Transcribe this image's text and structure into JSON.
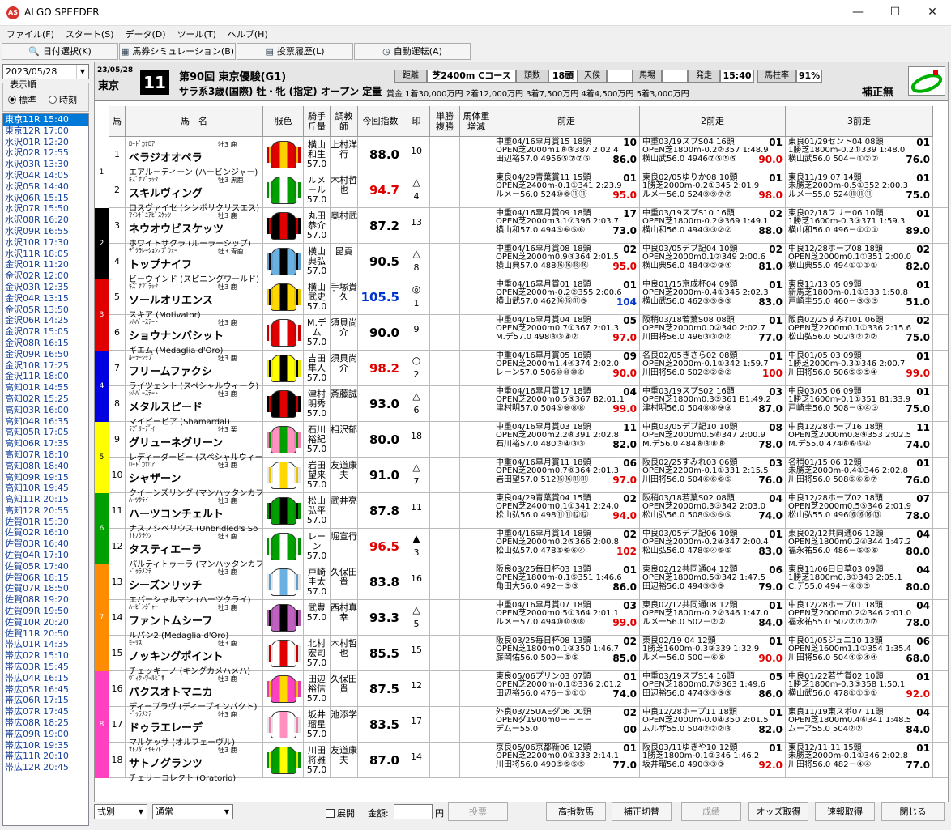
{
  "app": {
    "title": "ALGO SPEEDER",
    "icon": "AS"
  },
  "window": {
    "minimize": "—",
    "maximize": "☐",
    "close": "✕"
  },
  "menu": [
    "ファイル(F)",
    "スタート(S)",
    "データ(D)",
    "ツール(T)",
    "ヘルプ(H)"
  ],
  "toolbar": [
    {
      "icon": "🔍",
      "label": "日付選択(K)"
    },
    {
      "icon": "▦",
      "label": "馬券シミュレーション(B)"
    },
    {
      "icon": "▤",
      "label": "投票履歴(L)"
    },
    {
      "icon": "◷",
      "label": "自動運転(A)"
    }
  ],
  "left": {
    "date": "2023/05/28",
    "order_label": "表示順",
    "opt_standard": "標準",
    "opt_time": "時刻",
    "races": [
      "東京11R 15:40",
      "東京12R 17:00",
      "水沢01R 12:20",
      "水沢02R 12:55",
      "水沢03R 13:30",
      "水沢04R 14:05",
      "水沢05R 14:40",
      "水沢06R 15:15",
      "水沢07R 15:50",
      "水沢08R 16:20",
      "水沢09R 16:55",
      "水沢10R 17:30",
      "水沢11R 18:05",
      "金沢01R 11:20",
      "金沢02R 12:00",
      "金沢03R 12:35",
      "金沢04R 13:15",
      "金沢05R 13:50",
      "金沢06R 14:25",
      "金沢07R 15:05",
      "金沢08R 16:15",
      "金沢09R 16:50",
      "金沢10R 17:25",
      "金沢11R 18:00",
      "高知01R 14:55",
      "高知02R 15:25",
      "高知03R 16:00",
      "高知04R 16:35",
      "高知05R 17:05",
      "高知06R 17:35",
      "高知07R 18:10",
      "高知08R 18:40",
      "高知09R 19:15",
      "高知10R 19:45",
      "高知11R 20:15",
      "高知12R 20:55",
      "佐賀01R 15:30",
      "佐賀02R 16:10",
      "佐賀03R 16:40",
      "佐賀04R 17:10",
      "佐賀05R 17:40",
      "佐賀06R 18:15",
      "佐賀07R 18:50",
      "佐賀08R 19:20",
      "佐賀09R 19:50",
      "佐賀10R 20:20",
      "佐賀11R 20:50",
      "帯広01R 14:35",
      "帯広02R 15:10",
      "帯広03R 15:45",
      "帯広04R 16:15",
      "帯広05R 16:45",
      "帯広06R 17:15",
      "帯広07R 17:45",
      "帯広08R 18:25",
      "帯広09R 19:00",
      "帯広10R 19:35",
      "帯広11R 20:10",
      "帯広12R 20:45"
    ]
  },
  "race": {
    "date": "23/05/28",
    "place": "東京",
    "no": "11",
    "name": "第90回 東京優駿(G1)",
    "cond": "サラ系3歳(国際) 牡・牝 (指定) オープン 定量",
    "prize": "賞金 1着30,000万円 2着12,000万円 3着7,500万円 4着4,500万円 5着3,000万円",
    "dist_label": "距離",
    "dist": "芝2400m Cコース",
    "heads_label": "頭数",
    "heads": "18頭",
    "weather_label": "天候",
    "weather": "",
    "going_label": "馬場",
    "going": "",
    "post_label": "発走",
    "post": "15:40",
    "rate_label": "馬柱率",
    "rate": "91%",
    "fix": "補正無"
  },
  "cols": {
    "umaban": "馬",
    "name": "馬　名",
    "silk": "服色",
    "jockey": "騎手斤量",
    "trainer": "調教師",
    "idx": "今回指数",
    "mark": "印",
    "odds": "単勝複勝",
    "wt": "馬体重増減",
    "p1": "前走",
    "p2": "2前走",
    "p3": "3前走"
  },
  "colors": {
    "waku": [
      "#ffffff",
      "#000000",
      "#e00000",
      "#0000e0",
      "#ffff00",
      "#00a000",
      "#ff8c00",
      "#ff40c0"
    ]
  },
  "horses": [
    {
      "waku": "1",
      "no": "1",
      "sire": "ﾛｰﾄﾞｶﾅﾛｱ",
      "sex": "牡3 鹿",
      "name": "ベラジオオペラ",
      "dam": "エアルーティーン (ハービンジャー)",
      "jockey": "横山和生",
      "kin": "57.0",
      "trainer": "上村洋行",
      "idx": "88.0",
      "idxc": "#000",
      "mark": "",
      "pop": "10",
      "silk": [
        "#e00000",
        "#ffd000"
      ],
      "p1": [
        "中重04/16皐月賞15 18頭",
        "10",
        "OPEN芝2000m1⑧③387 2:02.4",
        "田辺裕57.0 4956⑤⑦⑦⑤",
        "86.0"
      ],
      "p2": [
        "中重03/19スプS04 16頭",
        "01",
        "OPEN芝1800m-0.2②357 1:48.9",
        "横山武56.0 4946⑦⑤⑤⑤",
        "90.0"
      ],
      "p3": [
        "東良01/29セント04 08頭",
        "01",
        "1勝芝1800m-0.2①339 1:48.0",
        "横山武56.0 504－①②②",
        "76.0"
      ]
    },
    {
      "waku": "1",
      "no": "2",
      "sire": "ｷｽﾞﾅﾌﾞﾗｯｸ",
      "sex": "牡3 黒鹿",
      "name": "スキルヴィング",
      "dam": "ロスヴァイセ (シンボリクリスエス)",
      "jockey": "ルメール",
      "kin": "57.0",
      "trainer": "木村哲也",
      "idx": "94.7",
      "idxc": "#e00000",
      "mark": "△",
      "pop": "4",
      "silk": [
        "#00a000",
        "#ffffff"
      ],
      "p1": [
        "東良04/29青葉賞11 15頭",
        "01",
        "OPEN芝2400m-0.1①341 2:23.9",
        "ルメー56.0 524⑩⑧⑪⑪",
        "95.0"
      ],
      "p2": [
        "東良02/05ゆりか08 10頭",
        "01",
        "1勝芝2000m-0.2①345 2:01.9",
        "ルメー56.0 524⑨⑨⑦⑦",
        "98.0"
      ],
      "p3": [
        "東良11/19 07 14頭",
        "01",
        "未勝芝2000m-0.5①352 2:00.3",
        "ルメー55.0 524⑪⑪⑪",
        "75.0"
      ]
    },
    {
      "waku": "2",
      "no": "3",
      "sire": "ﾏｲﾝﾄﾞﾕｱﾋﾞｽｹｯﾂ",
      "sex": "牡3 鹿",
      "name": "ネウオウビスケッツ",
      "dam": "ホワイトサクラ (ルーラーシップ)",
      "jockey": "丸田恭介",
      "kin": "57.0",
      "trainer": "奥村武",
      "idx": "87.2",
      "idxc": "#000",
      "mark": "",
      "pop": "13",
      "silk": [
        "#000000",
        "#e00000"
      ],
      "p1": [
        "中重04/16皐月賞09 18頭",
        "17",
        "OPEN芝2000m3.1⑦396 2:03.7",
        "横山和57.0 494⑤⑥⑤⑥",
        "73.0"
      ],
      "p2": [
        "中重03/19スプS10 16頭",
        "02",
        "OPEN芝1800m-0.2③369 1:49.1",
        "横山和56.0 494③③②②",
        "88.0"
      ],
      "p3": [
        "東良02/18フリー06 10頭",
        "01",
        "1勝芝1600m-0.3③371 1:59.3",
        "横山和56.0 496－①①①",
        "89.0"
      ]
    },
    {
      "waku": "2",
      "no": "4",
      "sire": "ﾃﾞｸﾗﾚｰｼｮﾝｵﾌﾞｳｫｰ",
      "sex": "牡3 青鹿",
      "name": "トップナイフ",
      "dam": "ビーウインド (スピニングワールド)",
      "jockey": "横山典弘",
      "kin": "57.0",
      "trainer": "昆貢",
      "idx": "90.5",
      "idxc": "#000",
      "mark": "△",
      "pop": "8",
      "silk": [
        "#6ab0e0",
        "#000000"
      ],
      "p1": [
        "中重04/16皐月賞08 18頭",
        "02",
        "OPEN芝2000m0.9③364 2:01.5",
        "横山典57.0 488⑯⑯⑱⑯",
        "95.0"
      ],
      "p2": [
        "中良03/05デブ記04 10頭",
        "02",
        "OPEN芝2000m0.1②349 2:00.6",
        "横山典56.0 484③②③④",
        "81.0"
      ],
      "p3": [
        "中良12/28ホープ08 18頭",
        "02",
        "OPEN芝2000m0.1①351 2:00.0",
        "横山典55.0 494①①①①",
        "82.0"
      ]
    },
    {
      "waku": "3",
      "no": "5",
      "sire": "ｷｽﾞﾅﾌﾞﾗｯｸ",
      "sex": "牡3 鹿",
      "name": "ソールオリエンス",
      "dam": "スキア (Motivator)",
      "jockey": "横山武史",
      "kin": "57.0",
      "trainer": "手塚貴久",
      "idx": "105.5",
      "idxc": "#0033cc",
      "mark": "◎",
      "pop": "1",
      "silk": [
        "#ffd800",
        "#000000"
      ],
      "p1": [
        "中重04/16皐月賞01 18頭",
        "01",
        "OPEN芝2000m-0.2②355 2:00.6",
        "横山武57.0 462⑯⑮⑪⑤",
        "104"
      ],
      "p2": [
        "中良01/15京成杯04 09頭",
        "01",
        "OPEN芝2000m-0.4①345 2:02.3",
        "横山武56.0 462⑤⑤⑤⑤",
        "83.0"
      ],
      "p3": [
        "東良11/13 05 09頭",
        "01",
        "新馬芝1800m-0.1①333 1:50.8",
        "戸崎圭55.0 460－③③③",
        "51.0"
      ]
    },
    {
      "waku": "3",
      "no": "6",
      "sire": "ｼﾙﾊﾞｰｽﾃｰﾄ",
      "sex": "牡3 鹿",
      "name": "ショウナンバシット",
      "dam": "ギエム (Medaglia d'Oro)",
      "jockey": "M.デム",
      "kin": "57.0",
      "trainer": "須貝尚介",
      "idx": "90.0",
      "idxc": "#000",
      "mark": "",
      "pop": "9",
      "silk": [
        "#e00000",
        "#ffffff"
      ],
      "p1": [
        "中重04/16皐月賞04 18頭",
        "05",
        "OPEN芝2000m0.7①367 2:01.3",
        "M.デ57.0 498③③④②",
        "97.0"
      ],
      "p2": [
        "阪稍03/18若葉S08 08頭",
        "01",
        "OPEN芝2000m0.0②340 2:02.7",
        "川田将56.0 496③③②②",
        "77.0"
      ],
      "p3": [
        "阪良02/25すみれ01 06頭",
        "02",
        "OPEN芝2200m0.1①336 2:15.6",
        "松山弘56.0 502③②②②",
        "75.0"
      ]
    },
    {
      "waku": "4",
      "no": "7",
      "sire": "ﾙｰﾗｰｼｯﾌﾟ",
      "sex": "牡3 鹿",
      "name": "フリームファクシ",
      "dam": "ライツェント (スペシャルウィーク)",
      "jockey": "吉田隼人",
      "kin": "57.0",
      "trainer": "須貝尚介",
      "idx": "98.2",
      "idxc": "#e00000",
      "mark": "○",
      "pop": "2",
      "silk": [
        "#ffff00",
        "#000000"
      ],
      "p1": [
        "中重04/16皐月賞05 18頭",
        "09",
        "OPEN芝2000m1.4④374 2:02.0",
        "レーン57.0 506⑩⑩⑩⑧",
        "90.0"
      ],
      "p2": [
        "名良02/05きさら02 08頭",
        "01",
        "OPEN芝2000m-0.1①342 1:59.7",
        "川田将56.0 502②②②②",
        "100"
      ],
      "p3": [
        "中良01/05 03 09頭",
        "01",
        "1勝芝2000m-0.3①346 2:00.7",
        "川田将56.0 506⑤⑤⑤④",
        "99.0"
      ]
    },
    {
      "waku": "4",
      "no": "8",
      "sire": "ｼﾙﾊﾞｰｽﾃｰﾄ",
      "sex": "牡3 鹿",
      "name": "メタルスピード",
      "dam": "マイビービア (Shamardal)",
      "jockey": "津村明秀",
      "kin": "57.0",
      "trainer": "斎藤誠",
      "idx": "93.0",
      "idxc": "#000",
      "mark": "△",
      "pop": "6",
      "silk": [
        "#000000",
        "#e00000"
      ],
      "p1": [
        "中重04/16皐月賞17 18頭",
        "04",
        "OPEN芝2000m0.5③367 B2:01.1",
        "津村明57.0 504⑨⑧⑧⑧",
        "99.0"
      ],
      "p2": [
        "中重03/19スプS02 16頭",
        "03",
        "OPEN芝1800m0.3③361 B1:49.2",
        "津村明56.0 504⑧⑧⑨⑨",
        "87.0"
      ],
      "p3": [
        "中良03/05 06 09頭",
        "01",
        "1勝芝1600m-0.1①351 B1:33.9",
        "戸崎圭56.0 508－④④③",
        "75.0"
      ]
    },
    {
      "waku": "5",
      "no": "9",
      "sire": "ﾗﾌﾞﾘｰﾃﾞｲ",
      "sex": "牡3 栗",
      "name": "グリューネグリーン",
      "dam": "レディーダービー (スペシャルウィーク)",
      "jockey": "石川裕紀",
      "kin": "57.0",
      "trainer": "相沢郁",
      "idx": "80.0",
      "idxc": "#000",
      "mark": "",
      "pop": "18",
      "silk": [
        "#ff90c0",
        "#00a000"
      ],
      "p1": [
        "中重04/16皐月賞03 18頭",
        "11",
        "OPEN芝2000m2.2⑧391 2:02.8",
        "石川裕57.0 480③④③③",
        "82.0"
      ],
      "p2": [
        "中良03/05デブ記10 10頭",
        "08",
        "OPEN芝2000m0.5⑥347 2:00.9",
        "M.デ56.0 484⑧⑧⑧⑧",
        "78.0"
      ],
      "p3": [
        "中良12/28ホープ16 18頭",
        "11",
        "OPEN芝2000m0.8⑨353 2:02.5",
        "M.デ55.0 474⑥⑥⑥④",
        "74.0"
      ]
    },
    {
      "waku": "5",
      "no": "10",
      "sire": "ﾛｰﾄﾞｶﾅﾛｱ",
      "sex": "牡3 鹿",
      "name": "シャザーン",
      "dam": "クイーンズリング (マンハッタンカフェ)",
      "jockey": "岩田望来",
      "kin": "57.0",
      "trainer": "友道康夫",
      "idx": "91.0",
      "idxc": "#000",
      "mark": "△",
      "pop": "7",
      "silk": [
        "#ffffff",
        "#ffd800"
      ],
      "p1": [
        "中重04/16皐月賞11 18頭",
        "06",
        "OPEN芝2000m0.7⑧364 2:01.3",
        "岩田望57.0 512⑮⑯⑪⑪",
        "97.0"
      ],
      "p2": [
        "阪良02/25すみれ03 06頭",
        "03",
        "OPEN芝2200m-0.1①331 2:15.5",
        "川田将56.0 504⑥⑥⑥⑥",
        "76.0"
      ],
      "p3": [
        "名稍01/15 06 12頭",
        "01",
        "未勝芝2000m-0.4①346 2:02.8",
        "川田将56.0 508⑥⑥⑥⑦",
        "76.0"
      ]
    },
    {
      "waku": "6",
      "no": "11",
      "sire": "ﾊｰﾂｸﾗｲ",
      "sex": "牡3 鹿",
      "name": "ハーツコンチェルト",
      "dam": "ナスノシベリウス (Unbridled's So",
      "jockey": "松山弘平",
      "kin": "57.0",
      "trainer": "武井亮",
      "idx": "87.8",
      "idxc": "#000",
      "mark": "",
      "pop": "11",
      "silk": [
        "#00a000",
        "#000000"
      ],
      "p1": [
        "東良04/29青葉賞04 15頭",
        "02",
        "OPEN芝2400m0.1①341 2:24.0",
        "松山弘56.0 498⑪⑪⑫⑫",
        "94.0"
      ],
      "p2": [
        "阪稍03/18若葉S02 08頭",
        "04",
        "OPEN芝2000m0.3③342 2:03.0",
        "松山弘56.0 508⑤⑤⑤⑤",
        "74.0"
      ],
      "p3": [
        "中良12/28ホープ02 18頭",
        "07",
        "OPEN芝2000m0.5⑤346 2:01.9",
        "松山弘55.0 496⑯⑯⑯⑬",
        "78.0"
      ]
    },
    {
      "waku": "6",
      "no": "12",
      "sire": "ｻﾄﾉｸﾗｳﾝ",
      "sex": "牡3 鹿",
      "name": "タスティエーラ",
      "dam": "パルティトゥーラ (マンハッタンカフェ)",
      "jockey": "レーン",
      "kin": "57.0",
      "trainer": "堀宣行",
      "idx": "96.5",
      "idxc": "#e00000",
      "mark": "▲",
      "pop": "3",
      "silk": [
        "#00a000",
        "#ffffff"
      ],
      "p1": [
        "中重04/16皐月賞14 18頭",
        "02",
        "OPEN芝2000m0.2⑤366 2:00.8",
        "松山弘57.0 478⑤⑥⑥④",
        "102"
      ],
      "p2": [
        "中良03/05デブ記06 10頭",
        "01",
        "OPEN芝2000m-0.2④347 2:00.4",
        "松山弘56.0 478⑤④⑤⑤",
        "83.0"
      ],
      "p3": [
        "東良02/12共同通06 12頭",
        "04",
        "OPEN芝1800m0.2④344 1:47.2",
        "福永祐56.0 486－⑤⑤⑥",
        "80.0"
      ]
    },
    {
      "waku": "7",
      "no": "13",
      "sire": "ﾄﾞｩﾗﾒﾝﾃ",
      "sex": "牡3 鹿",
      "name": "シーズンリッチ",
      "dam": "エバーシャルマン (ハーツクライ)",
      "jockey": "戸崎圭太",
      "kin": "57.0",
      "trainer": "久保田貴",
      "idx": "83.8",
      "idxc": "#000",
      "mark": "",
      "pop": "16",
      "silk": [
        "#ffffff",
        "#6ab0e0"
      ],
      "p1": [
        "阪良03/25毎日杯03 13頭",
        "01",
        "OPEN芝1800m-0.1⑤351 1:46.6",
        "角田大56.0 492－⑤⑤",
        "86.0"
      ],
      "p2": [
        "東良02/12共同通04 12頭",
        "06",
        "OPEN芝1800m0.5①342 1:47.5",
        "田辺裕56.0 494⑤⑤⑤",
        "79.0"
      ],
      "p3": [
        "東良11/06日日草03 09頭",
        "04",
        "1勝芝1800m0.8①343 2:05.1",
        "C.デ55.0 494－④⑤⑤",
        "80.0"
      ]
    },
    {
      "waku": "7",
      "no": "14",
      "sire": "ﾊｰﾋﾞﾝｼﾞｬｰ",
      "sex": "牡3 鹿",
      "name": "ファントムシーフ",
      "dam": "ルパン2 (Medaglia d'Oro)",
      "jockey": "武豊",
      "kin": "57.0",
      "trainer": "西村真幸",
      "idx": "93.3",
      "idxc": "#000",
      "mark": "△",
      "pop": "5",
      "silk": [
        "#c060c0",
        "#000000"
      ],
      "p1": [
        "中重04/16皐月賞07 18頭",
        "03",
        "OPEN芝2000m0.5①364 2:01.1",
        "ルメー57.0 494⑩⑩⑨⑧",
        "99.0"
      ],
      "p2": [
        "東良02/12共同通08 12頭",
        "01",
        "OPEN芝1800m-0.2②346 1:47.0",
        "ルメー56.0 502－②②",
        "84.0"
      ],
      "p3": [
        "中良12/28ホープ01 18頭",
        "04",
        "OPEN芝2000m0.2②346 2:01.0",
        "福永祐55.0 502⑦⑦⑦⑦",
        "78.0"
      ]
    },
    {
      "waku": "7",
      "no": "15",
      "sire": "ﾓｰﾘｽ",
      "sex": "牡3 鹿",
      "name": "ノッキングポイント",
      "dam": "チェッキーノ (キングカメハメハ)",
      "jockey": "北村宏司",
      "kin": "57.0",
      "trainer": "木村哲也",
      "idx": "85.5",
      "idxc": "#000",
      "mark": "",
      "pop": "15",
      "silk": [
        "#ffffff",
        "#e00000"
      ],
      "p1": [
        "阪良03/25毎日杯08 13頭",
        "02",
        "OPEN芝1800m0.1③350 1:46.7",
        "藤岡佑56.0 500－⑤⑤",
        "85.0"
      ],
      "p2": [
        "東良02/19 04 12頭",
        "01",
        "1勝芝1600m-0.3③339 1:32.9",
        "ルメー56.0 500－⑥⑥",
        "90.0"
      ],
      "p3": [
        "中良01/05ジュニ10 13頭",
        "06",
        "OPEN芝1600m1.1①354 1:35.4",
        "川田将56.0 504④⑤④④",
        "68.0"
      ]
    },
    {
      "waku": "8",
      "no": "16",
      "sire": "ｳﾞｨｸﾄﾜｰﾙﾋﾟｻ",
      "sex": "牡3 鹿",
      "name": "パクスオトマニカ",
      "dam": "ディープラヴ (ディープインパクト)",
      "jockey": "田辺裕信",
      "kin": "57.0",
      "trainer": "久保田貴",
      "idx": "87.5",
      "idxc": "#000",
      "mark": "",
      "pop": "12",
      "silk": [
        "#ff40c0",
        "#ffd800"
      ],
      "p1": [
        "東良05/06プリン03 07頭",
        "01",
        "OPEN芝2000m-0.1②336 2:01.2",
        "田辺裕56.0 476－①①①",
        "74.0"
      ],
      "p2": [
        "中重03/19スプS14 16頭",
        "05",
        "OPEN芝1800m0.7③363 1:49.6",
        "田辺裕56.0 474③③③③",
        "86.0"
      ],
      "p3": [
        "中良01/22若竹賞02 10頭",
        "01",
        "1勝芝1800m-0.3③358 1:50.1",
        "横山武56.0 478①①①①",
        "92.0"
      ]
    },
    {
      "waku": "8",
      "no": "17",
      "sire": "ﾄﾞｩﾗﾒﾝﾃ",
      "sex": "牡3 鹿",
      "name": "ドゥラエレーデ",
      "dam": "マルケッサ (オルフェーヴル)",
      "jockey": "坂井瑠星",
      "kin": "57.0",
      "trainer": "池添学",
      "idx": "83.5",
      "idxc": "#000",
      "mark": "",
      "pop": "17",
      "silk": [
        "#ffffff",
        "#ff90c0"
      ],
      "p1": [
        "外良03/25UAEダ06 00頭",
        "02",
        "OPENダ1900m0－－－－",
        "デムー55.0",
        "00"
      ],
      "p2": [
        "中良12/28ホープ11 18頭",
        "01",
        "OPEN芝2000m-0.0④350 2:01.5",
        "ムルザ55.0 504②②②③",
        "82.0"
      ],
      "p3": [
        "東良11/19東スポ07 11頭",
        "04",
        "OPEN芝1800m0.4⑥341 1:48.5",
        "ムーア55.0 504②②",
        "84.0"
      ]
    },
    {
      "waku": "8",
      "no": "18",
      "sire": "ｻﾄﾉﾀﾞｲﾔﾓﾝﾄﾞ",
      "sex": "牡3 鹿",
      "name": "サトノグランツ",
      "dam": "チェリーコレクト (Oratorio)",
      "jockey": "川田将雅",
      "kin": "57.0",
      "trainer": "友道康夫",
      "idx": "87.0",
      "idxc": "#000",
      "mark": "",
      "pop": "14",
      "silk": [
        "#00a000",
        "#ffff00"
      ],
      "p1": [
        "京良05/06京都新06 12頭",
        "01",
        "OPEN芝2200m0.0①333 2:14.1",
        "川田将56.0 490⑤⑤⑤⑤",
        "77.0"
      ],
      "p2": [
        "阪良03/11ゆきや10 12頭",
        "01",
        "1勝芝1800m-0.1②346 1:46.2",
        "坂井瑠56.0 490③③③",
        "92.0"
      ],
      "p3": [
        "東良12/11 11 15頭",
        "01",
        "未勝芝2000m-0.1①346 2:02.8",
        "川田将56.0 482－④④",
        "77.0"
      ]
    }
  ],
  "bottom": {
    "sel1": "式別",
    "sel2": "通常",
    "open_label": "展開",
    "amount_label": "金額:",
    "amount_unit": "円",
    "vote": "投票",
    "high": "高指数馬",
    "fix_toggle": "補正切替",
    "result": "成績",
    "odds": "オッズ取得",
    "fast": "速報取得",
    "close": "閉じる"
  }
}
